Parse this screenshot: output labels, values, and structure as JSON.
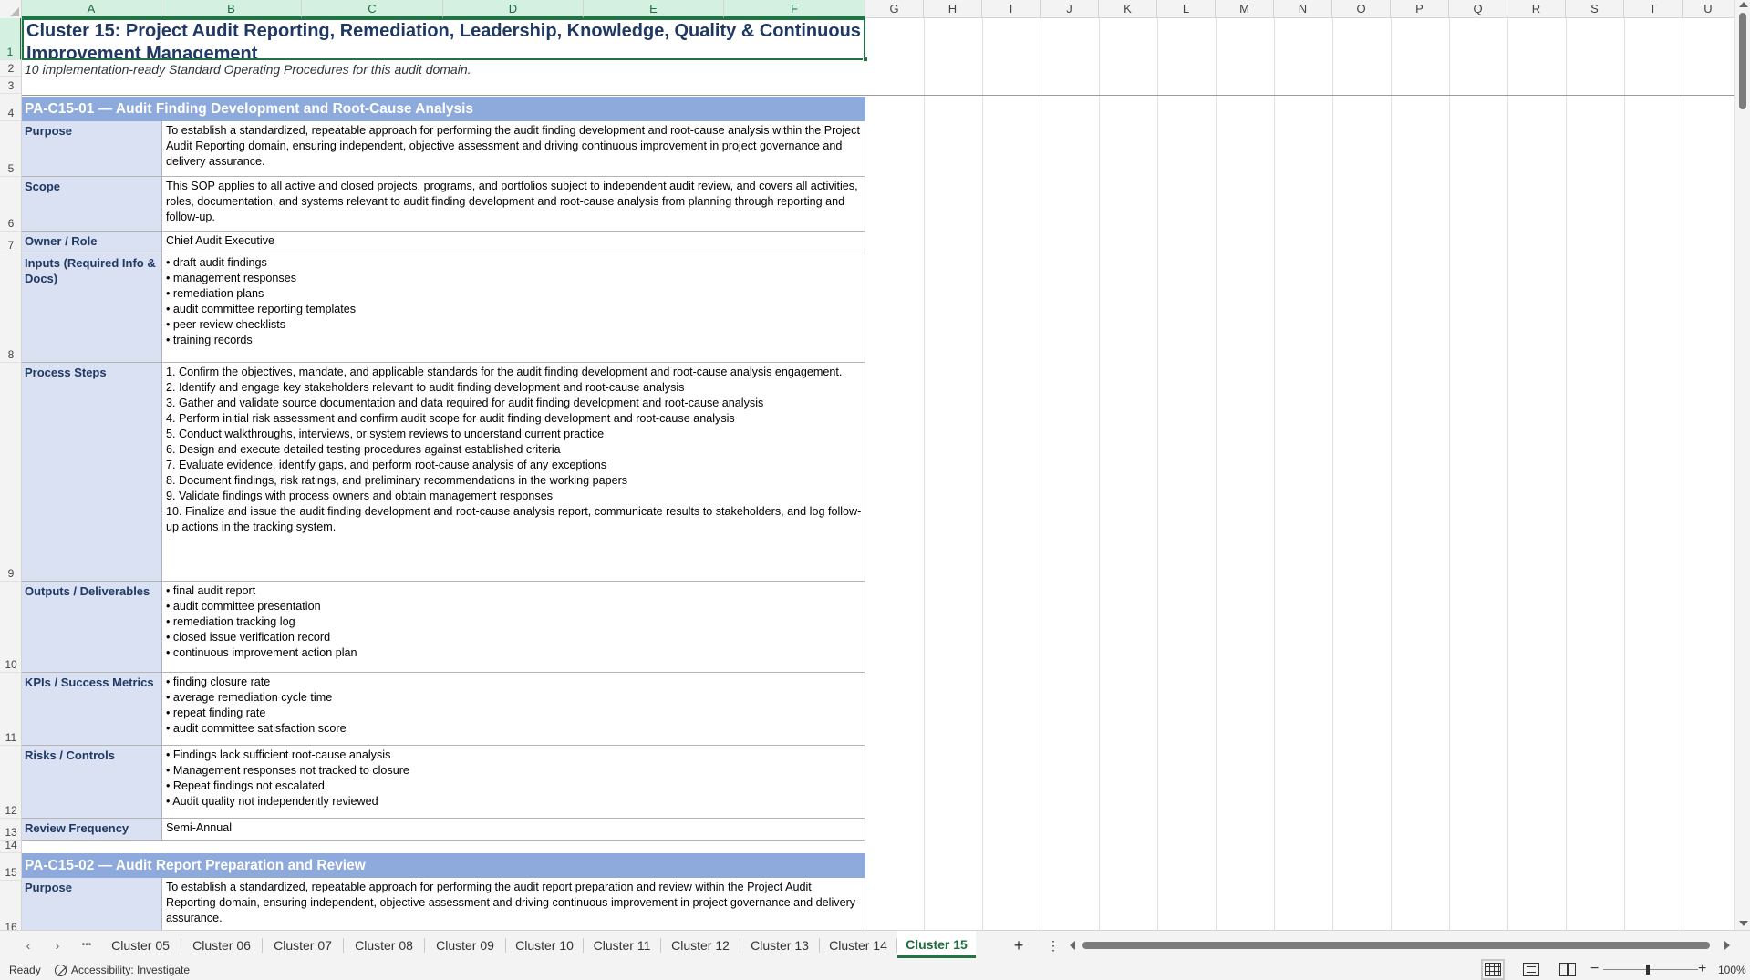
{
  "columns": [
    "A",
    "B",
    "C",
    "D",
    "E",
    "F",
    "G",
    "H",
    "I",
    "J",
    "K",
    "L",
    "M",
    "N",
    "O",
    "P",
    "Q",
    "R",
    "S",
    "T",
    "U"
  ],
  "row_numbers": [
    "1",
    "2",
    "3",
    "4",
    "5",
    "6",
    "7",
    "8",
    "9",
    "10",
    "11",
    "12",
    "13",
    "14",
    "15",
    "16"
  ],
  "title": "Cluster 15: Project Audit Reporting, Remediation, Leadership, Knowledge, Quality & Continuous Improvement Management",
  "subtitle": "10 implementation-ready Standard Operating Procedures for this audit domain.",
  "sop1": {
    "header": "PA-C15-01  —  Audit Finding Development and Root-Cause Analysis",
    "purpose_label": "Purpose",
    "purpose": "To establish a standardized, repeatable approach for performing the audit finding development and root-cause analysis within the Project Audit Reporting domain, ensuring independent, objective assessment and driving continuous improvement in project governance and delivery assurance.",
    "scope_label": "Scope",
    "scope": "This SOP applies to all active and closed projects, programs, and portfolios subject to independent audit review, and covers all activities, roles, documentation, and systems relevant to audit finding development and root-cause analysis from planning through reporting and follow-up.",
    "owner_label": "Owner / Role",
    "owner": "Chief Audit Executive",
    "inputs_label": "Inputs (Required Info & Docs)",
    "inputs": "• draft audit findings\n• management responses\n• remediation plans\n• audit committee reporting templates\n• peer review checklists\n• training records",
    "steps_label": "Process Steps",
    "steps": "1. Confirm the objectives, mandate, and applicable standards for the audit finding development and root-cause analysis engagement.\n2. Identify and engage key stakeholders relevant to audit finding development and root-cause analysis\n3. Gather and validate source documentation and data required for audit finding development and root-cause analysis\n4. Perform initial risk assessment and confirm audit scope for audit finding development and root-cause analysis\n5. Conduct walkthroughs, interviews, or system reviews to understand current practice\n6. Design and execute detailed testing procedures against established criteria\n7. Evaluate evidence, identify gaps, and perform root-cause analysis of any exceptions\n8. Document findings, risk ratings, and preliminary recommendations in the working papers\n9. Validate findings with process owners and obtain management responses\n10. Finalize and issue the audit finding development and root-cause analysis report, communicate results to stakeholders, and log follow-up actions in the tracking system.",
    "outputs_label": "Outputs / Deliverables",
    "outputs": "• final audit report\n• audit committee presentation\n• remediation tracking log\n• closed issue verification record\n• continuous improvement action plan",
    "kpis_label": "KPIs / Success Metrics",
    "kpis": "• finding closure rate\n• average remediation cycle time\n• repeat finding rate\n• audit committee satisfaction score",
    "risks_label": "Risks / Controls",
    "risks": "• Findings lack sufficient root-cause analysis\n• Management responses not tracked to closure\n• Repeat findings not escalated\n• Audit quality not independently reviewed",
    "review_label": "Review Frequency",
    "review": "Semi-Annual"
  },
  "sop2": {
    "header": "PA-C15-02  —  Audit Report Preparation and Review",
    "purpose_label": "Purpose",
    "purpose": "To establish a standardized, repeatable approach for performing the audit report preparation and review within the Project Audit Reporting domain, ensuring independent, objective assessment and driving continuous improvement in project governance and delivery assurance."
  },
  "tabs": [
    "Cluster 05",
    "Cluster 06",
    "Cluster 07",
    "Cluster 08",
    "Cluster 09",
    "Cluster 10",
    "Cluster 11",
    "Cluster 12",
    "Cluster 13",
    "Cluster 14",
    "Cluster 15"
  ],
  "active_tab": "Cluster 15",
  "tab_overflow": "•••",
  "add_sheet": "+",
  "more_options": "⋮",
  "status": {
    "ready": "Ready",
    "accessibility": "Accessibility: Investigate",
    "zoom": "100%"
  },
  "colors": {
    "accent": "#217346",
    "header_fill": "#8ea9db",
    "label_fill": "#d9e1f2",
    "title_text": "#1f3864"
  }
}
